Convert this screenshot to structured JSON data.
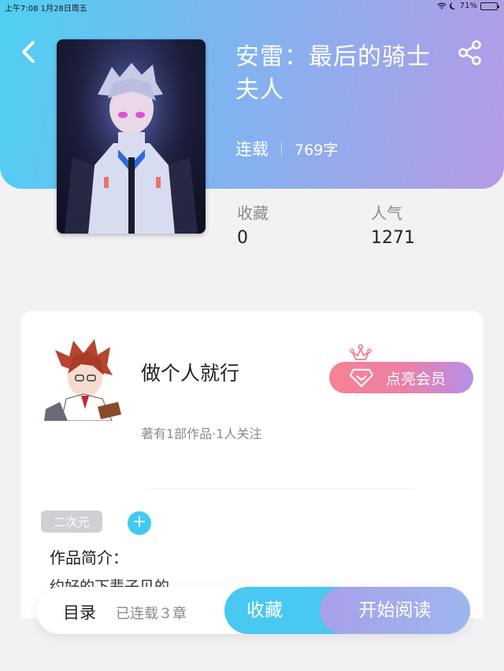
{
  "status_bar": {
    "time": "上午7:08  1月28日周五",
    "battery": "71%",
    "battery_level": 0.71
  },
  "header": {
    "back_icon": "chevron-left-icon",
    "share_icon": "share-icon"
  },
  "book": {
    "title": "安雷：最后的骑士夫人",
    "status": "连载",
    "word_count": "769字",
    "stats": [
      {
        "label": "收藏",
        "value": "0"
      },
      {
        "label": "人气",
        "value": "1271"
      }
    ]
  },
  "author": {
    "name": "做个人就行",
    "stats": "著有1部作品·1人关注",
    "vip_button": "点亮会员"
  },
  "tags": [
    {
      "label": "二次元"
    }
  ],
  "add_tag_label": "+",
  "intro": {
    "label": "作品简介：",
    "text": "约好的下辈子见的"
  },
  "bottom_bar": {
    "toc_label": "目录",
    "chapter_count": "已连载３章",
    "collect_label": "收藏",
    "read_label": "开始阅读"
  },
  "colors": {
    "header_gradient_start": "#4fd0f2",
    "header_gradient_end": "#b69be6",
    "collect_button": "#49c8f1",
    "vip_gradient_start": "#f78294",
    "vip_gradient_end": "#b490e8"
  }
}
